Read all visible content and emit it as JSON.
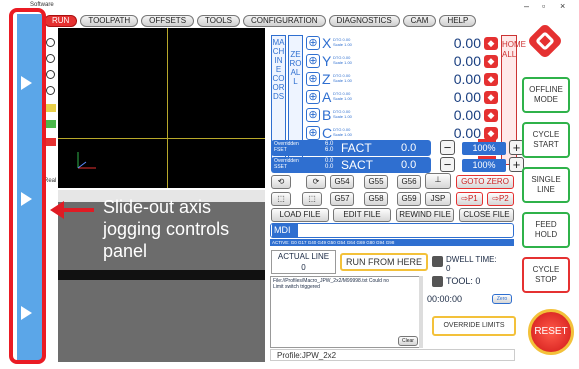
{
  "window": {
    "app_name": "Software",
    "min_glyph": "–",
    "max_glyph": "▫",
    "close_glyph": "×"
  },
  "menu": {
    "tabs": [
      "RUN",
      "TOOLPATH",
      "OFFSETS",
      "TOOLS",
      "CONFIGURATION",
      "DIAGNOSTICS",
      "CAM",
      "HELP"
    ],
    "active": "RUN"
  },
  "toolpath": {
    "side_label": "Real"
  },
  "annotation": {
    "text": "Slide-out axis jogging controls panel"
  },
  "dro": {
    "machine_coords_label": "MACHINE COORDS",
    "zero_all_label": "ZERO ALL",
    "home_all_label": "HOME ALL",
    "axes": [
      {
        "letter": "X",
        "sub1": "DTG 0.00",
        "sub2": "Scale 1.00",
        "value": "0.00"
      },
      {
        "letter": "Y",
        "sub1": "DTG 0.00",
        "sub2": "Scale 1.00",
        "value": "0.00"
      },
      {
        "letter": "Z",
        "sub1": "DTG 0.00",
        "sub2": "Scale 1.00",
        "value": "0.00"
      },
      {
        "letter": "A",
        "sub1": "DTG 0.00",
        "sub2": "Scale 1.00",
        "value": "0.00"
      },
      {
        "letter": "B",
        "sub1": "DTG 0.00",
        "sub2": "Scale 1.00",
        "value": "0.00"
      },
      {
        "letter": "C",
        "sub1": "DTG 0.00",
        "sub2": "Scale 1.00",
        "value": "0.00"
      }
    ]
  },
  "feed": {
    "overridden": "Overridden",
    "set_label": "FSET",
    "set_value": "6.0",
    "set_value2": "6.0",
    "act_label": "FACT",
    "act_value": "0.0",
    "percent": "100%"
  },
  "speed": {
    "overridden": "Overridden",
    "set_label": "SSET",
    "set_value": "0.0",
    "set_value2": "0.0",
    "act_label": "SACT",
    "act_value": "0.0",
    "percent": "100%"
  },
  "buttons": {
    "g54": "G54",
    "g55": "G55",
    "g56": "G56",
    "g57": "G57",
    "g58": "G58",
    "g59": "G59",
    "goto_zero": "GOTO ZERO",
    "jsp": "JSP",
    "p1": "⇨P1",
    "p2": "⇨P2",
    "load_file": "LOAD FILE",
    "edit_file": "EDIT FILE",
    "rewind_file": "REWIND FILE",
    "close_file": "CLOSE FILE",
    "run_from_here": "RUN FROM HERE",
    "override_limits": "OVERRIDE LIMITS",
    "clear": "Clear",
    "zero": "Zero",
    "reset": "RESET"
  },
  "right_panel": {
    "offline_mode": "OFFLINE MODE",
    "cycle_start": "CYCLE START",
    "single_line": "SINGLE LINE",
    "feed_hold": "FEED HOLD",
    "cycle_stop": "CYCLE STOP"
  },
  "mdi": {
    "label": "MDI",
    "active_codes": "ACTIVE: G0 G17 G40 G49 G50 G54 G64 G69 G80 G94 G98"
  },
  "status": {
    "actual_line_label": "ACTUAL LINE",
    "actual_line_value": "0",
    "dwell_label": "DWELL TIME:",
    "dwell_value": "0",
    "tool_label": "TOOL:",
    "tool_value": "0",
    "timer": "00:00:00",
    "log_line1": "File://Profiles/Macro_JPW_2x2/M99998.txt Could no",
    "log_line2": "Limit switch triggered",
    "profile": "Profile:JPW_2x2"
  }
}
